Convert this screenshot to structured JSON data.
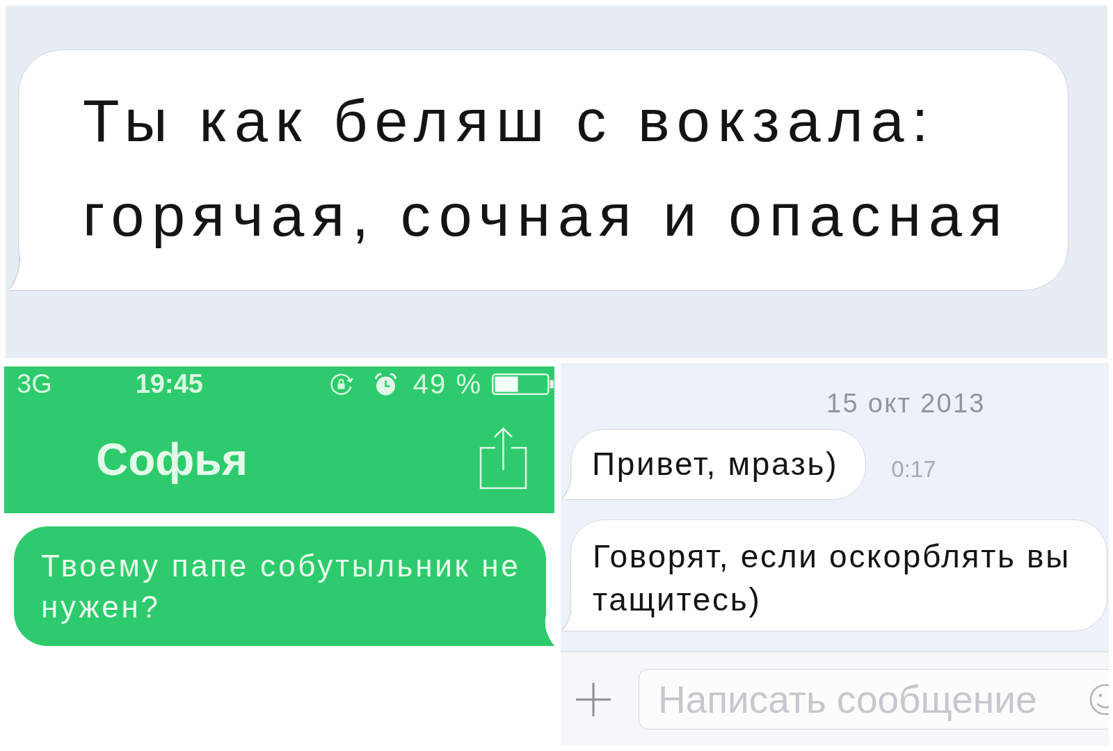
{
  "top_chat": {
    "messages": [
      {
        "text": "Ты как беляш с вокзала: горячая, сочная и опасная"
      }
    ]
  },
  "left_chat": {
    "status_bar": {
      "network": "3G",
      "time": "19:45",
      "battery": "49 %"
    },
    "contact_name": "Софья",
    "messages": [
      {
        "text": "Твоему папе собутыльник не нужен?"
      }
    ]
  },
  "right_chat": {
    "date": "15 окт 2013",
    "messages": [
      {
        "text": "Привет, мразь)",
        "time": "0:17"
      },
      {
        "text": "Говорят, если оскорблять вы тащитесь)"
      }
    ],
    "composer": {
      "placeholder": "Написать сообщение"
    }
  }
}
